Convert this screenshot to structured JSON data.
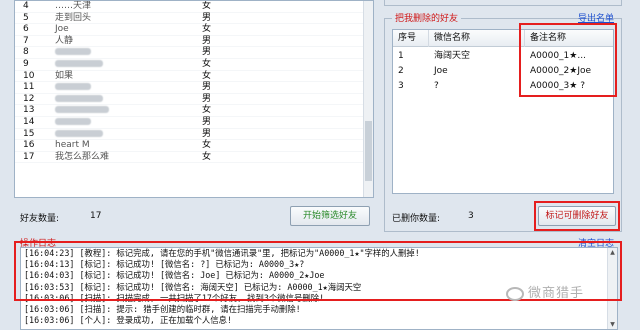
{
  "left_list": {
    "rows": [
      {
        "idx": "4",
        "name": "……天津",
        "gender": "女"
      },
      {
        "idx": "5",
        "name": "走到回头",
        "gender": "男"
      },
      {
        "idx": "6",
        "name": "Joe",
        "gender": "女"
      },
      {
        "idx": "7",
        "name": "人静",
        "gender": "男"
      },
      {
        "idx": "8",
        "name": "",
        "gender": "男"
      },
      {
        "idx": "9",
        "name": "",
        "gender": "女"
      },
      {
        "idx": "10",
        "name": "如果",
        "gender": "女"
      },
      {
        "idx": "11",
        "name": "",
        "gender": "男"
      },
      {
        "idx": "12",
        "name": "",
        "gender": "男"
      },
      {
        "idx": "13",
        "name": "",
        "gender": "女"
      },
      {
        "idx": "14",
        "name": "",
        "gender": "男"
      },
      {
        "idx": "15",
        "name": "",
        "gender": "男"
      },
      {
        "idx": "16",
        "name": "heart M",
        "gender": "女"
      },
      {
        "idx": "17",
        "name": "我怎么那么难",
        "gender": "女"
      }
    ]
  },
  "friend_count": {
    "label": "好友数量:",
    "value": "17"
  },
  "start_button": "开始筛选好友",
  "deleted_panel": {
    "title": "把我删除的好友",
    "export_link": "导出名单",
    "columns": [
      "序号",
      "微信名称",
      "备注名称"
    ],
    "rows": [
      {
        "idx": "1",
        "wechat": "海阔天空",
        "remark": "A0000_1★..."
      },
      {
        "idx": "2",
        "wechat": "Joe",
        "remark": "A0000_2★Joe"
      },
      {
        "idx": "3",
        "wechat": "?",
        "remark": "A0000_3★ ?"
      }
    ]
  },
  "deleted_count": {
    "label": "已删你数量:",
    "value": "3"
  },
  "mark_button": "标记可删除好友",
  "log": {
    "title": "操作日志",
    "clear_link": "清空日志",
    "lines": [
      "[16:04:23] [教程]: 标记完成, 请在您的手机\"微信通讯录\"里, 把标记为\"A0000_1★\"字样的人删掉!",
      "[16:04:13] [标记]: 标记成功! [微信名: ?] 已标记为: A0000_3★?",
      "[16:04:03] [标记]: 标记成功! [微信名: Joe] 已标记为: A0000_2★Joe",
      "[16:03:53] [标记]: 标记成功! [微信名: 海阔天空] 已标记为: A0000_1★海阔天空",
      "[16:03:06] [扫描]: 扫描完成, 一共扫描了17个好友, 找到3个微信号删除!",
      "[16:03:06] [扫描]: 提示: 猎手创建的临时群, 请在扫描完手动删除!",
      "[16:03:06] [个人]: 登录成功, 正在加载个人信息!"
    ]
  },
  "watermark": "微商猎手"
}
